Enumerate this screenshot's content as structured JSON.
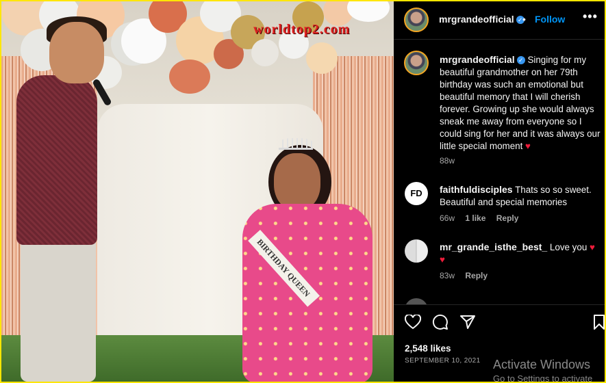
{
  "watermark": "worldtop2.com",
  "photo": {
    "description_icon": "post-photo",
    "sash_text": "BIRTHDAY QUEEN"
  },
  "header": {
    "username": "mrgrandeofficial",
    "verified_icon": "verified-badge-icon",
    "separator": "•",
    "follow_label": "Follow",
    "more_icon": "more-options-icon"
  },
  "caption": {
    "username": "mrgrandeofficial",
    "text": "Singing for my beautiful grandmother on her 79th birthday was such an emotional but beautiful memory that I will cherish forever. Growing up she would always sneak me away from everyone so I could sing for her and it was always our little special moment",
    "time": "88w"
  },
  "comments": [
    {
      "username": "faithfuldisciples",
      "avatar_text": "FD",
      "text": "Thats so so sweet. Beautiful and special memories",
      "time": "66w",
      "likes": "1 like",
      "reply": "Reply"
    },
    {
      "username": "mr_grande_isthe_best_",
      "text": "Love you",
      "time": "83w",
      "reply": "Reply"
    }
  ],
  "actions": {
    "like_icon": "heart-icon",
    "comment_icon": "comment-icon",
    "share_icon": "share-icon",
    "save_icon": "bookmark-icon",
    "likes": "2,548 likes",
    "date": "SEPTEMBER 10, 2021"
  },
  "system_overlay": {
    "title": "Activate Windows",
    "subtitle": "Go to Settings to activate"
  },
  "colors": {
    "follow": "#0095f6",
    "verified": "#3897f0",
    "heart": "#ed1c3a",
    "frame": "#ffe600"
  }
}
